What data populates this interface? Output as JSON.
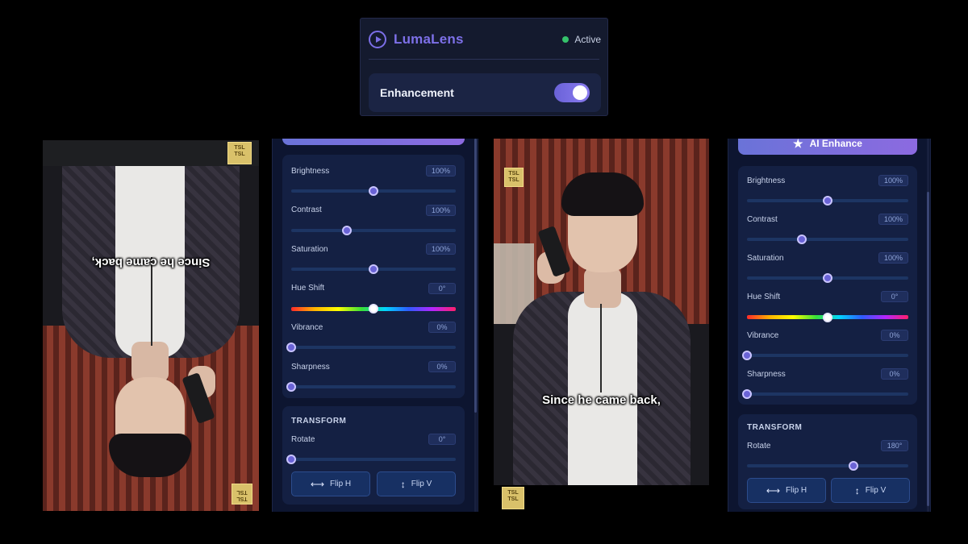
{
  "header": {
    "brand": "LumaLens",
    "status": "Active",
    "enhancement_label": "Enhancement",
    "enhancement_on": true
  },
  "video": {
    "caption": "Since he came back,",
    "badge_text": "TSL"
  },
  "panel_left": {
    "sliders": [
      {
        "label": "Brightness",
        "value": "100%",
        "fraction": 0.5
      },
      {
        "label": "Contrast",
        "value": "100%",
        "fraction": 0.34
      },
      {
        "label": "Saturation",
        "value": "100%",
        "fraction": 0.5
      },
      {
        "label": "Hue Shift",
        "value": "0°",
        "fraction": 0.5
      },
      {
        "label": "Vibrance",
        "value": "0%",
        "fraction": 0.0
      },
      {
        "label": "Sharpness",
        "value": "0%",
        "fraction": 0.0
      }
    ],
    "transform_title": "TRANSFORM",
    "rotate_label": "Rotate",
    "rotate_value": "0°",
    "rotate_fraction": 0.0,
    "flip_h": "Flip H",
    "flip_v": "Flip V"
  },
  "panel_right": {
    "ai_enhance": "AI Enhance",
    "sliders": [
      {
        "label": "Brightness",
        "value": "100%",
        "fraction": 0.5
      },
      {
        "label": "Contrast",
        "value": "100%",
        "fraction": 0.34
      },
      {
        "label": "Saturation",
        "value": "100%",
        "fraction": 0.5
      },
      {
        "label": "Hue Shift",
        "value": "0°",
        "fraction": 0.5
      },
      {
        "label": "Vibrance",
        "value": "0%",
        "fraction": 0.0
      },
      {
        "label": "Sharpness",
        "value": "0%",
        "fraction": 0.0
      }
    ],
    "transform_title": "TRANSFORM",
    "rotate_label": "Rotate",
    "rotate_value": "180°",
    "rotate_fraction": 0.66,
    "flip_h": "Flip H",
    "flip_v": "Flip V"
  },
  "colors": {
    "accent": "#7d70e8",
    "status_active": "#35c26b",
    "panel_bg": "#0d1530"
  }
}
